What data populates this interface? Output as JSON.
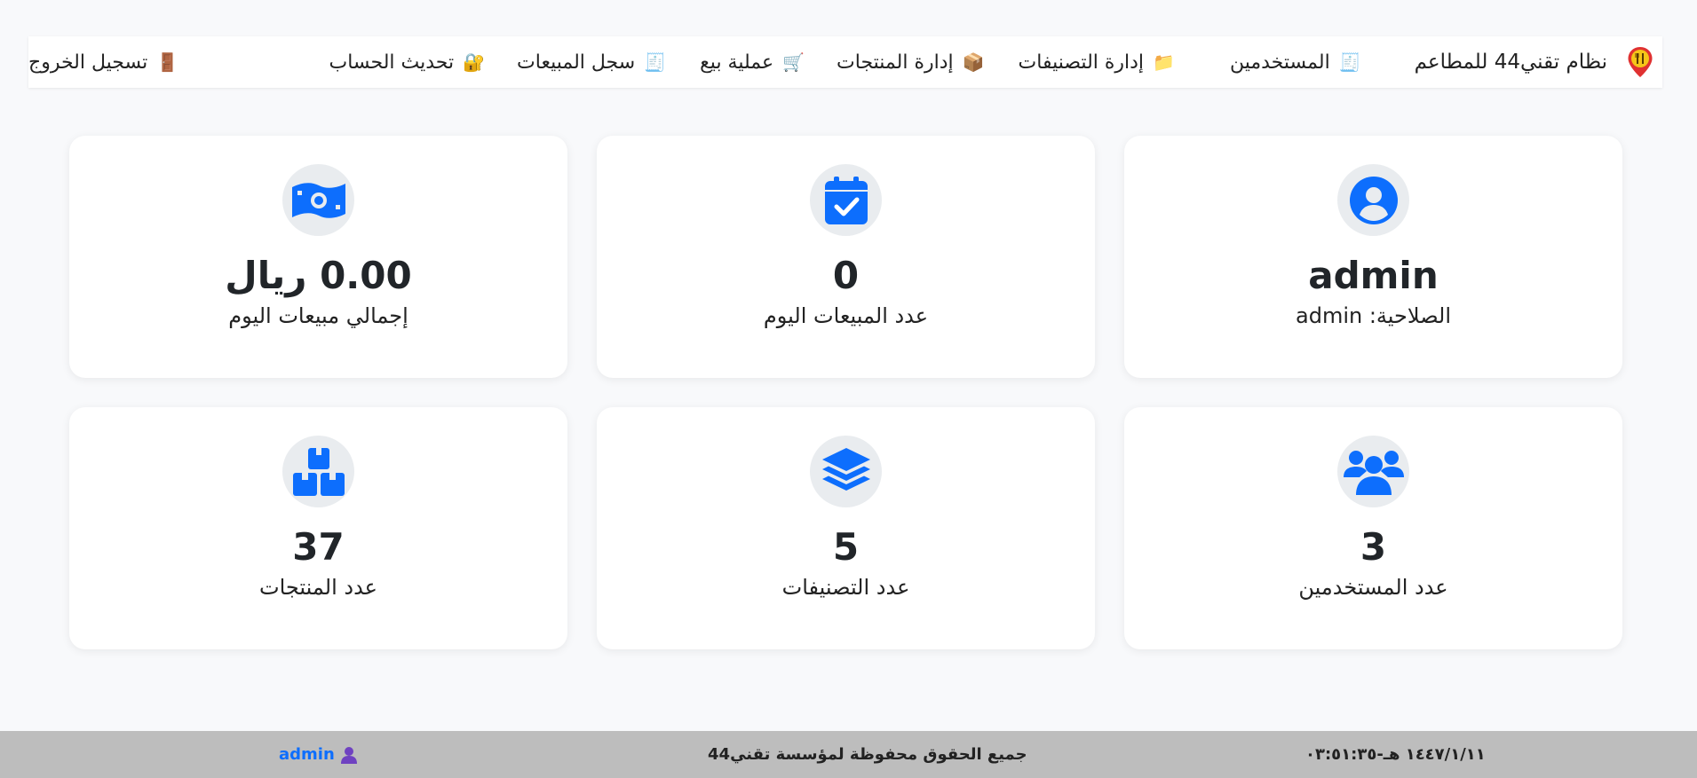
{
  "brand": {
    "title": "نظام تقني44 للمطاعم",
    "logo_icon": "restaurant-pin-icon"
  },
  "nav": {
    "users": {
      "label": "المستخدمين",
      "icon": "🧾"
    },
    "categories": {
      "label": "إدارة التصنيفات",
      "icon": "📁"
    },
    "products": {
      "label": "إدارة المنتجات",
      "icon": "📦"
    },
    "sale": {
      "label": "عملية بيع",
      "icon": "🛒"
    },
    "sales_log": {
      "label": "سجل المبيعات",
      "icon": "🧾"
    },
    "update_account": {
      "label": "تحديث الحساب",
      "icon": "🔐"
    },
    "logout": {
      "label": "تسجيل الخروج",
      "icon": "🚪"
    }
  },
  "cards": {
    "user": {
      "value": "admin",
      "label": "الصلاحية: admin",
      "icon": "user-circle-icon"
    },
    "sales_count": {
      "value": "0",
      "label": "عدد المبيعات اليوم",
      "icon": "calendar-check-icon"
    },
    "sales_total": {
      "value": "0.00 ريال",
      "label": "إجمالي مبيعات اليوم",
      "icon": "money-bill-icon"
    },
    "users_count": {
      "value": "3",
      "label": "عدد المستخدمين",
      "icon": "users-icon"
    },
    "categories_count": {
      "value": "5",
      "label": "عدد التصنيفات",
      "icon": "layers-icon"
    },
    "products_count": {
      "value": "37",
      "label": "عدد المنتجات",
      "icon": "boxes-icon"
    }
  },
  "footer": {
    "datetime": "١٤٤٧/١/١١ هـ-٠٣:٥١:٣٥",
    "copyright": "جميع الحقوق محفوظة لمؤسسة تقني44",
    "user": "admin",
    "user_icon": "user-icon"
  },
  "colors": {
    "accent": "#0d6efd",
    "footer_bg": "#bdbdbd",
    "icon_bg": "#e9ecef"
  }
}
